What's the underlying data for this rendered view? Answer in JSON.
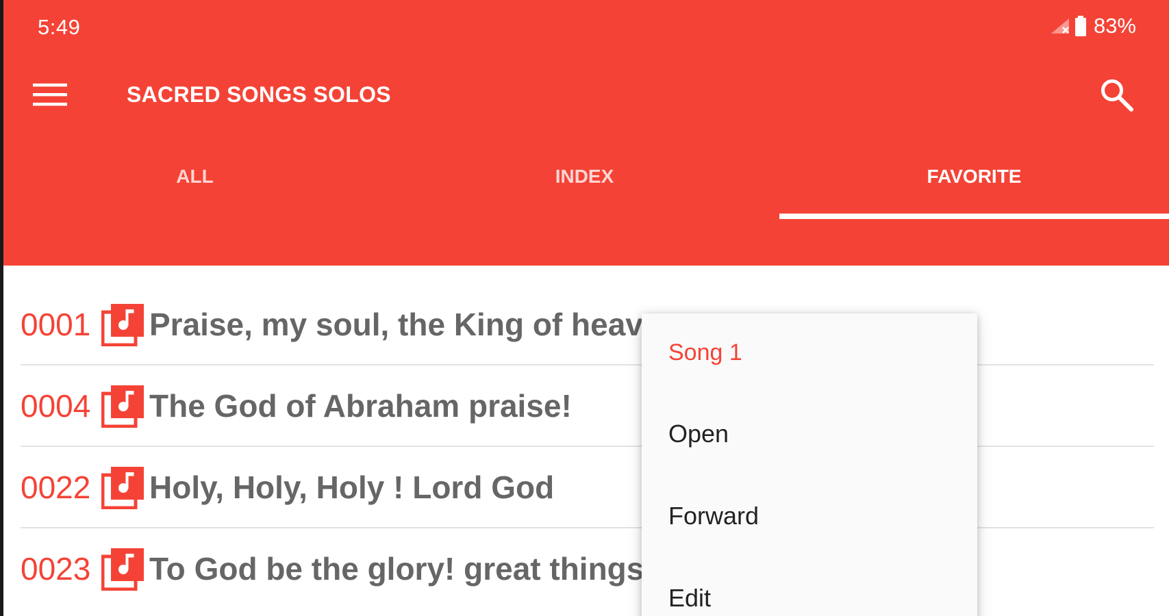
{
  "status_bar": {
    "time": "5:49",
    "battery": "83%",
    "icons": [
      "signal-icon",
      "battery-icon"
    ]
  },
  "app_bar": {
    "title": "SACRED SONGS SOLOS",
    "icons": [
      "menu-icon",
      "search-icon"
    ]
  },
  "tabs": [
    {
      "label": "ALL",
      "active": false
    },
    {
      "label": "INDEX",
      "active": false
    },
    {
      "label": "FAVORITE",
      "active": true
    }
  ],
  "songs": [
    {
      "number": "0001",
      "title": "Praise, my soul, the King of heav"
    },
    {
      "number": "0004",
      "title": "The God of Abraham praise!"
    },
    {
      "number": "0022",
      "title": "Holy, Holy, Holy ! Lord God"
    },
    {
      "number": "0023",
      "title": "To God be the glory! great things"
    }
  ],
  "context_menu": {
    "header": "Song 1",
    "items": [
      "Open",
      "Forward",
      "Edit"
    ]
  },
  "colors": {
    "primary": "#f44336",
    "song_title": "#666666",
    "divider": "#e3e3e3"
  }
}
